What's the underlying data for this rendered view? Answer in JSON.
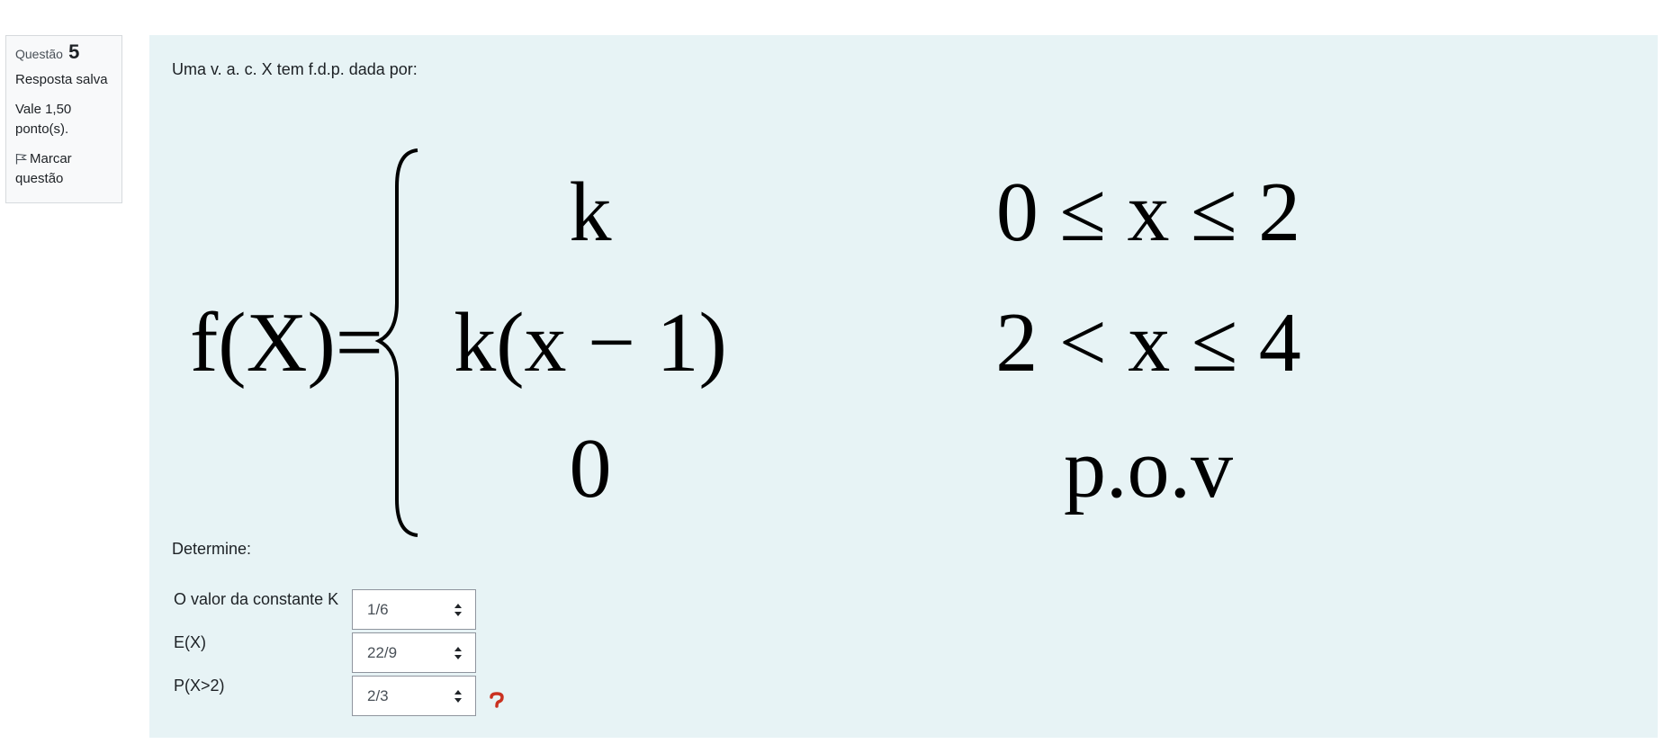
{
  "question_info": {
    "label": "Questão",
    "number": "5",
    "state": "Resposta salva",
    "grade": "Vale 1,50 ponto(s).",
    "flag_label": "Marcar questão"
  },
  "question": {
    "intro": "Uma v. a. c. X tem f.d.p. dada por:",
    "formula": {
      "lhs": "f(X)=",
      "cases": [
        {
          "expr": "k",
          "cond": "0 ≤ x ≤ 2"
        },
        {
          "expr": "k(x − 1)",
          "cond": "2 < x ≤ 4"
        },
        {
          "expr": "0",
          "cond": "p.o.v"
        }
      ]
    },
    "determine": "Determine:",
    "subquestions": [
      {
        "label": "O valor da constante K",
        "selected": "1/6"
      },
      {
        "label": "E(X)",
        "selected": "22/9"
      },
      {
        "label": "P(X>2)",
        "selected": "2/3"
      }
    ]
  },
  "colors": {
    "content_bg": "#e7f3f5",
    "info_bg": "#f8f9fa",
    "incorrect_icon": "#ca3120"
  },
  "icons": {
    "flag": "flag-icon",
    "select_arrows": "sort-arrows-icon",
    "incorrect": "incorrect-icon"
  }
}
